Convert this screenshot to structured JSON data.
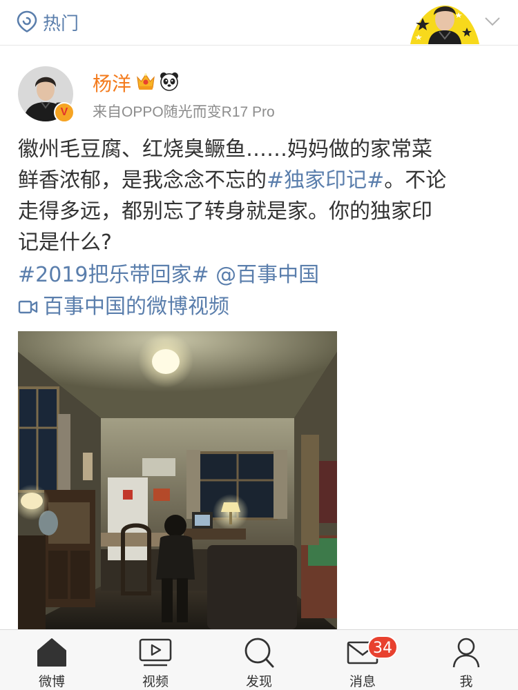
{
  "header": {
    "hot_label": "热门",
    "location_icon": "location-pin-icon",
    "dropdown_icon": "chevron-down-icon"
  },
  "post": {
    "username": "杨洋",
    "source": "来自OPPO随光而变R17 Pro",
    "verified_badge": "V",
    "text_lines": [
      {
        "pre": "徽州毛豆腐、红烧臭鳜鱼……妈妈做的家常菜",
        "tag": "",
        "post": ""
      },
      {
        "pre": "鲜香浓郁，是我念念不忘的",
        "tag": "#独家印记#",
        "post": "。不论"
      },
      {
        "pre": "走得多远，都别忘了转身就是家。你的独家印",
        "tag": "",
        "post": ""
      },
      {
        "pre": "记是什么?",
        "tag": "",
        "post": ""
      }
    ],
    "topic_link": "#2019把乐带回家#",
    "mention_link": "@百事中国",
    "video_link": "百事中国的微博视频"
  },
  "tabbar": {
    "tabs": [
      {
        "label": "微博",
        "icon": "home-icon"
      },
      {
        "label": "视频",
        "icon": "video-play-icon"
      },
      {
        "label": "发现",
        "icon": "search-icon"
      },
      {
        "label": "消息",
        "icon": "mail-icon",
        "badge": "34"
      },
      {
        "label": "我",
        "icon": "profile-icon"
      }
    ]
  },
  "colors": {
    "link_blue": "#5a7eac",
    "username_orange": "#f37b1d",
    "badge_red": "#e8412f"
  }
}
